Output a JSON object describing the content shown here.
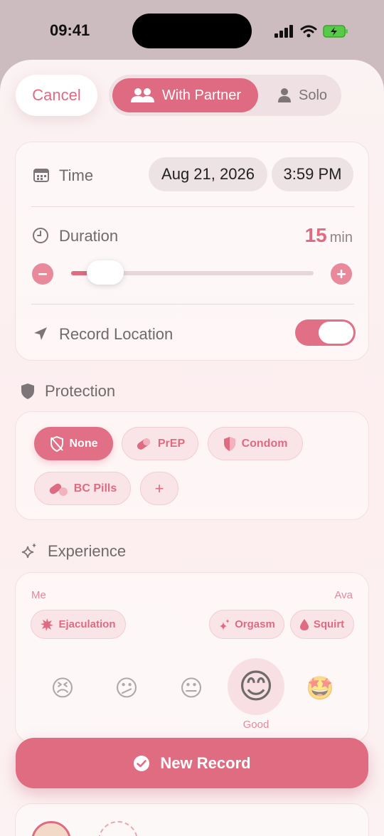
{
  "status": {
    "time": "09:41"
  },
  "header": {
    "cancel_label": "Cancel",
    "mode": {
      "with_partner": "With Partner",
      "solo": "Solo",
      "selected": "With Partner"
    }
  },
  "time_card": {
    "time_label": "Time",
    "date": "Aug 21, 2026",
    "time": "3:59 PM",
    "duration_label": "Duration",
    "duration_value": "15",
    "duration_unit": "min",
    "location_label": "Record Location",
    "location_enabled": true
  },
  "protection": {
    "title": "Protection",
    "options": [
      {
        "label": "None",
        "selected": true
      },
      {
        "label": "PrEP",
        "selected": false
      },
      {
        "label": "Condom",
        "selected": false
      },
      {
        "label": "BC Pills",
        "selected": false
      }
    ],
    "add_label": "+"
  },
  "experience": {
    "title": "Experience",
    "me_label": "Me",
    "partner_label": "Ava",
    "me_chips": [
      {
        "label": "Ejaculation"
      }
    ],
    "partner_chips": [
      {
        "label": "Orgasm"
      },
      {
        "label": "Squirt"
      }
    ],
    "moods": [
      "😣",
      "😕",
      "😐",
      "😊",
      "🤩"
    ],
    "selected_mood_label": "Good"
  },
  "actions": {
    "new_record_label": "New Record"
  },
  "colors": {
    "accent": "#de6b82",
    "background": "#fbf2f3"
  }
}
